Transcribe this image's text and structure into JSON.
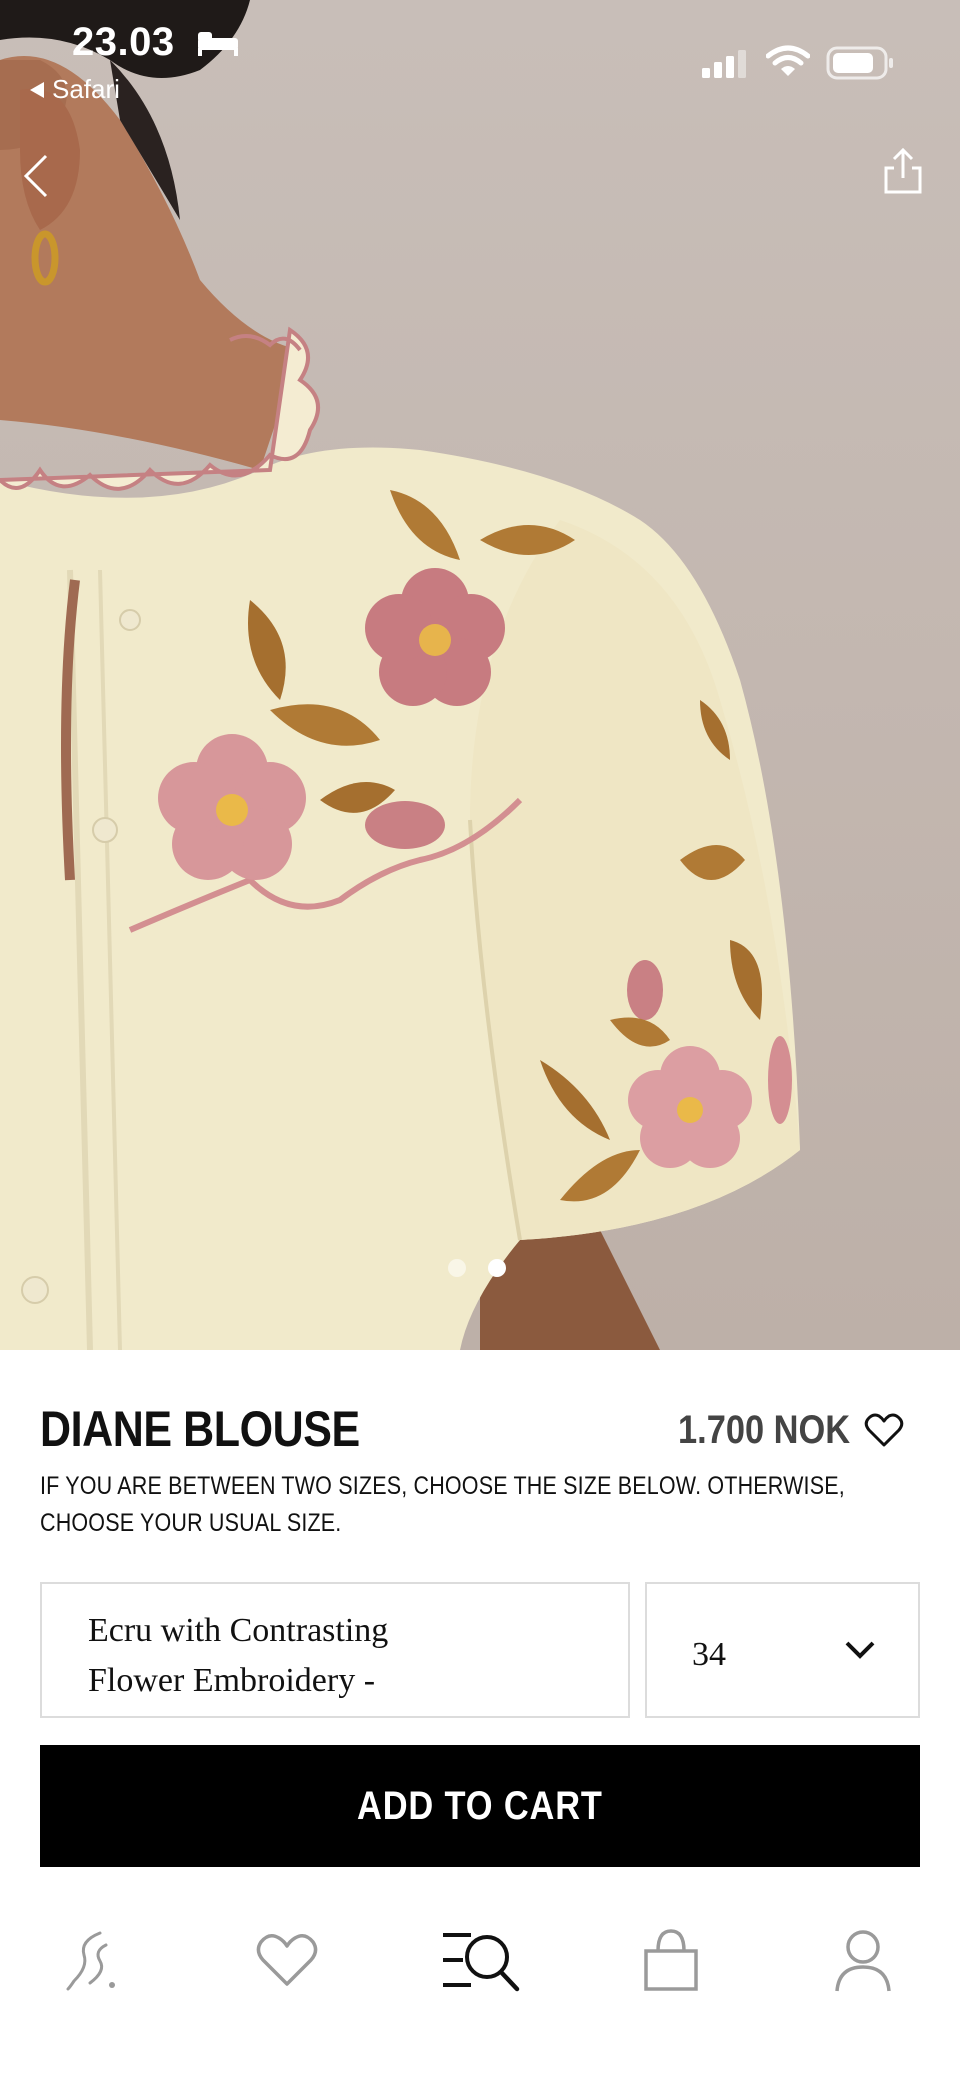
{
  "status_bar": {
    "time": "23.03",
    "back_app": "Safari"
  },
  "hero": {
    "image_alt": "Model wearing ecru blouse with flower embroidery",
    "page_count": 2,
    "active_page": 2
  },
  "product": {
    "title": "DIANE BLOUSE",
    "price": "1.700 NOK",
    "size_note": "IF YOU ARE BETWEEN TWO SIZES, CHOOSE THE SIZE BELOW. OTHERWISE, CHOOSE YOUR USUAL SIZE.",
    "color_line1": "Ecru with Contrasting",
    "color_line2": "Flower Embroidery -",
    "size_value": "34",
    "add_to_cart": "ADD TO CART"
  },
  "tab_bar": {
    "items": [
      "home-logo-icon",
      "wishlist-heart-icon",
      "menu-search-icon",
      "bag-icon",
      "account-icon"
    ],
    "active": "menu-search-icon"
  },
  "colors": {
    "button_bg": "#000000",
    "hero_bg": "#c4b8b1",
    "blouse": "#f2ebcc",
    "embroidery_pink": "#cf8a8c",
    "embroidery_brown": "#b07a35"
  }
}
